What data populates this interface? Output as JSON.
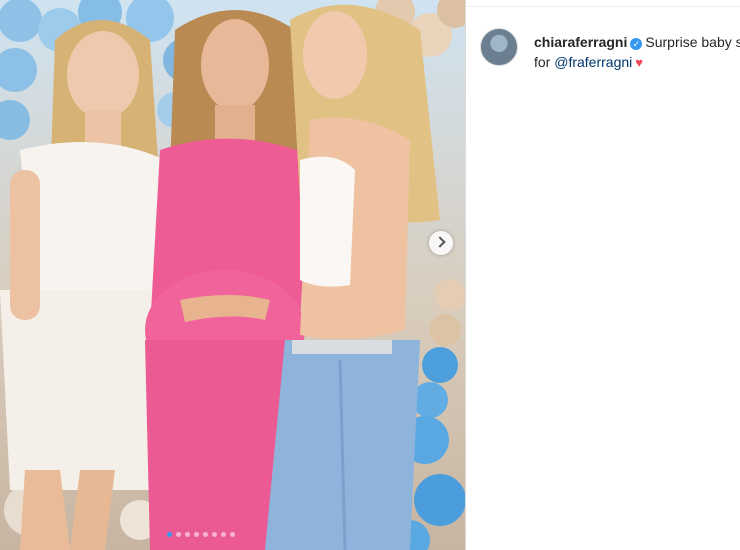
{
  "post": {
    "username": "chiaraferragni",
    "caption": "Surprise baby s",
    "caption_line2_prefix": "for",
    "mention": "@fraferragni",
    "heart": "♥"
  },
  "carousel": {
    "total_slides": 8,
    "active_index": 0
  },
  "icons": {
    "verified": "verified-badge-icon",
    "next": "chevron-right-icon",
    "heart": "heart-icon"
  },
  "colors": {
    "accent": "#3897f0",
    "mention": "#00376b",
    "heart": "#ed4956",
    "divider": "#dbdbdb"
  }
}
